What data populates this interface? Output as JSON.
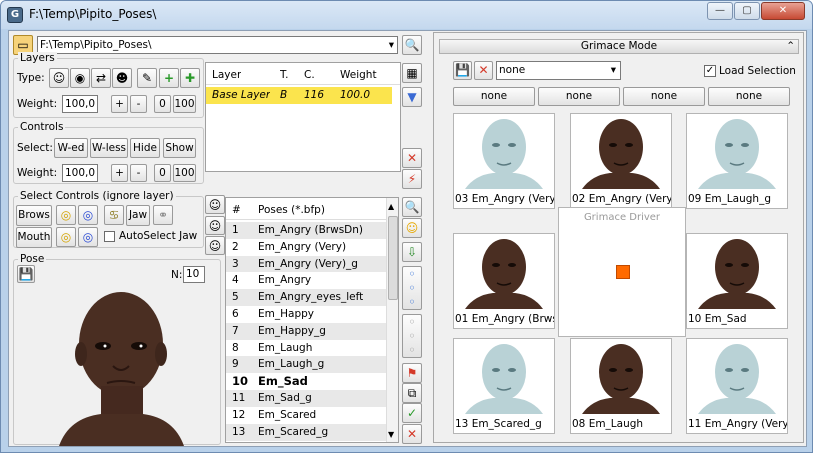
{
  "window": {
    "title": "F:\\Temp\\Pipito_Poses\\",
    "minimize": "—",
    "maximize": "▢",
    "close": "✕"
  },
  "path": {
    "value": "F:\\Temp\\Pipito_Poses\\"
  },
  "layers": {
    "title": "Layers",
    "type_label": "Type:",
    "weight_label": "Weight:",
    "weight_value": "100,0",
    "plus": "+",
    "minus": "-",
    "zero": "0",
    "hundred": "100",
    "columns": [
      "Layer",
      "T.",
      "C.",
      "Weight"
    ],
    "rows": [
      {
        "layer": "Base Layer",
        "t": "B",
        "c": "116",
        "weight": "100.0"
      }
    ]
  },
  "controls": {
    "title": "Controls",
    "select_label": "Select:",
    "w_ed": "W-ed",
    "w_less": "W-less",
    "hide": "Hide",
    "show": "Show",
    "weight_label": "Weight:",
    "weight_value": "100,0",
    "plus": "+",
    "minus": "-",
    "zero": "0",
    "hundred": "100"
  },
  "select_controls": {
    "title": "Select Controls (ignore layer)",
    "brows": "Brows",
    "jaw": "Jaw",
    "mouth": "Mouth",
    "autoselect": "AutoSelect Jaw"
  },
  "pose": {
    "title": "Pose",
    "n_label": "N:",
    "n_value": "10"
  },
  "poses": {
    "col_num": "#",
    "col_name": "Poses (*.bfp)",
    "items": [
      {
        "n": "1",
        "name": "Em_Angry (BrwsDn)"
      },
      {
        "n": "2",
        "name": "Em_Angry (Very)"
      },
      {
        "n": "3",
        "name": "Em_Angry (Very)_g"
      },
      {
        "n": "4",
        "name": "Em_Angry"
      },
      {
        "n": "5",
        "name": "Em_Angry_eyes_left"
      },
      {
        "n": "6",
        "name": "Em_Happy"
      },
      {
        "n": "7",
        "name": "Em_Happy_g"
      },
      {
        "n": "8",
        "name": "Em_Laugh"
      },
      {
        "n": "9",
        "name": "Em_Laugh_g"
      },
      {
        "n": "10",
        "name": "Em_Sad"
      },
      {
        "n": "11",
        "name": "Em_Sad_g"
      },
      {
        "n": "12",
        "name": "Em_Scared"
      },
      {
        "n": "13",
        "name": "Em_Scared_g"
      }
    ],
    "selected_index": 9
  },
  "grimace": {
    "title": "Grimace Mode",
    "preset_value": "none",
    "load_selection": "Load Selection",
    "slots": [
      "none",
      "none",
      "none",
      "none"
    ],
    "driver_title": "Grimace Driver",
    "thumbs": [
      {
        "caption": "03  Em_Angry (Very",
        "skin": "pale"
      },
      {
        "caption": "02  Em_Angry (Very",
        "skin": "dark"
      },
      {
        "caption": "09  Em_Laugh_g",
        "skin": "pale"
      },
      {
        "caption": "01  Em_Angry (Brws",
        "skin": "dark"
      },
      {
        "caption": "10  Em_Sad",
        "skin": "dark"
      },
      {
        "caption": "13  Em_Scared_g",
        "skin": "pale"
      },
      {
        "caption": "08  Em_Laugh",
        "skin": "dark"
      },
      {
        "caption": "11  Em_Angry (Very",
        "skin": "pale"
      }
    ]
  },
  "colors": {
    "selected_layer": "#fbe44d",
    "driver_handle": "#ff6a00",
    "dark_skin": "#4a2e22",
    "pale_skin": "#b9d2d6"
  }
}
